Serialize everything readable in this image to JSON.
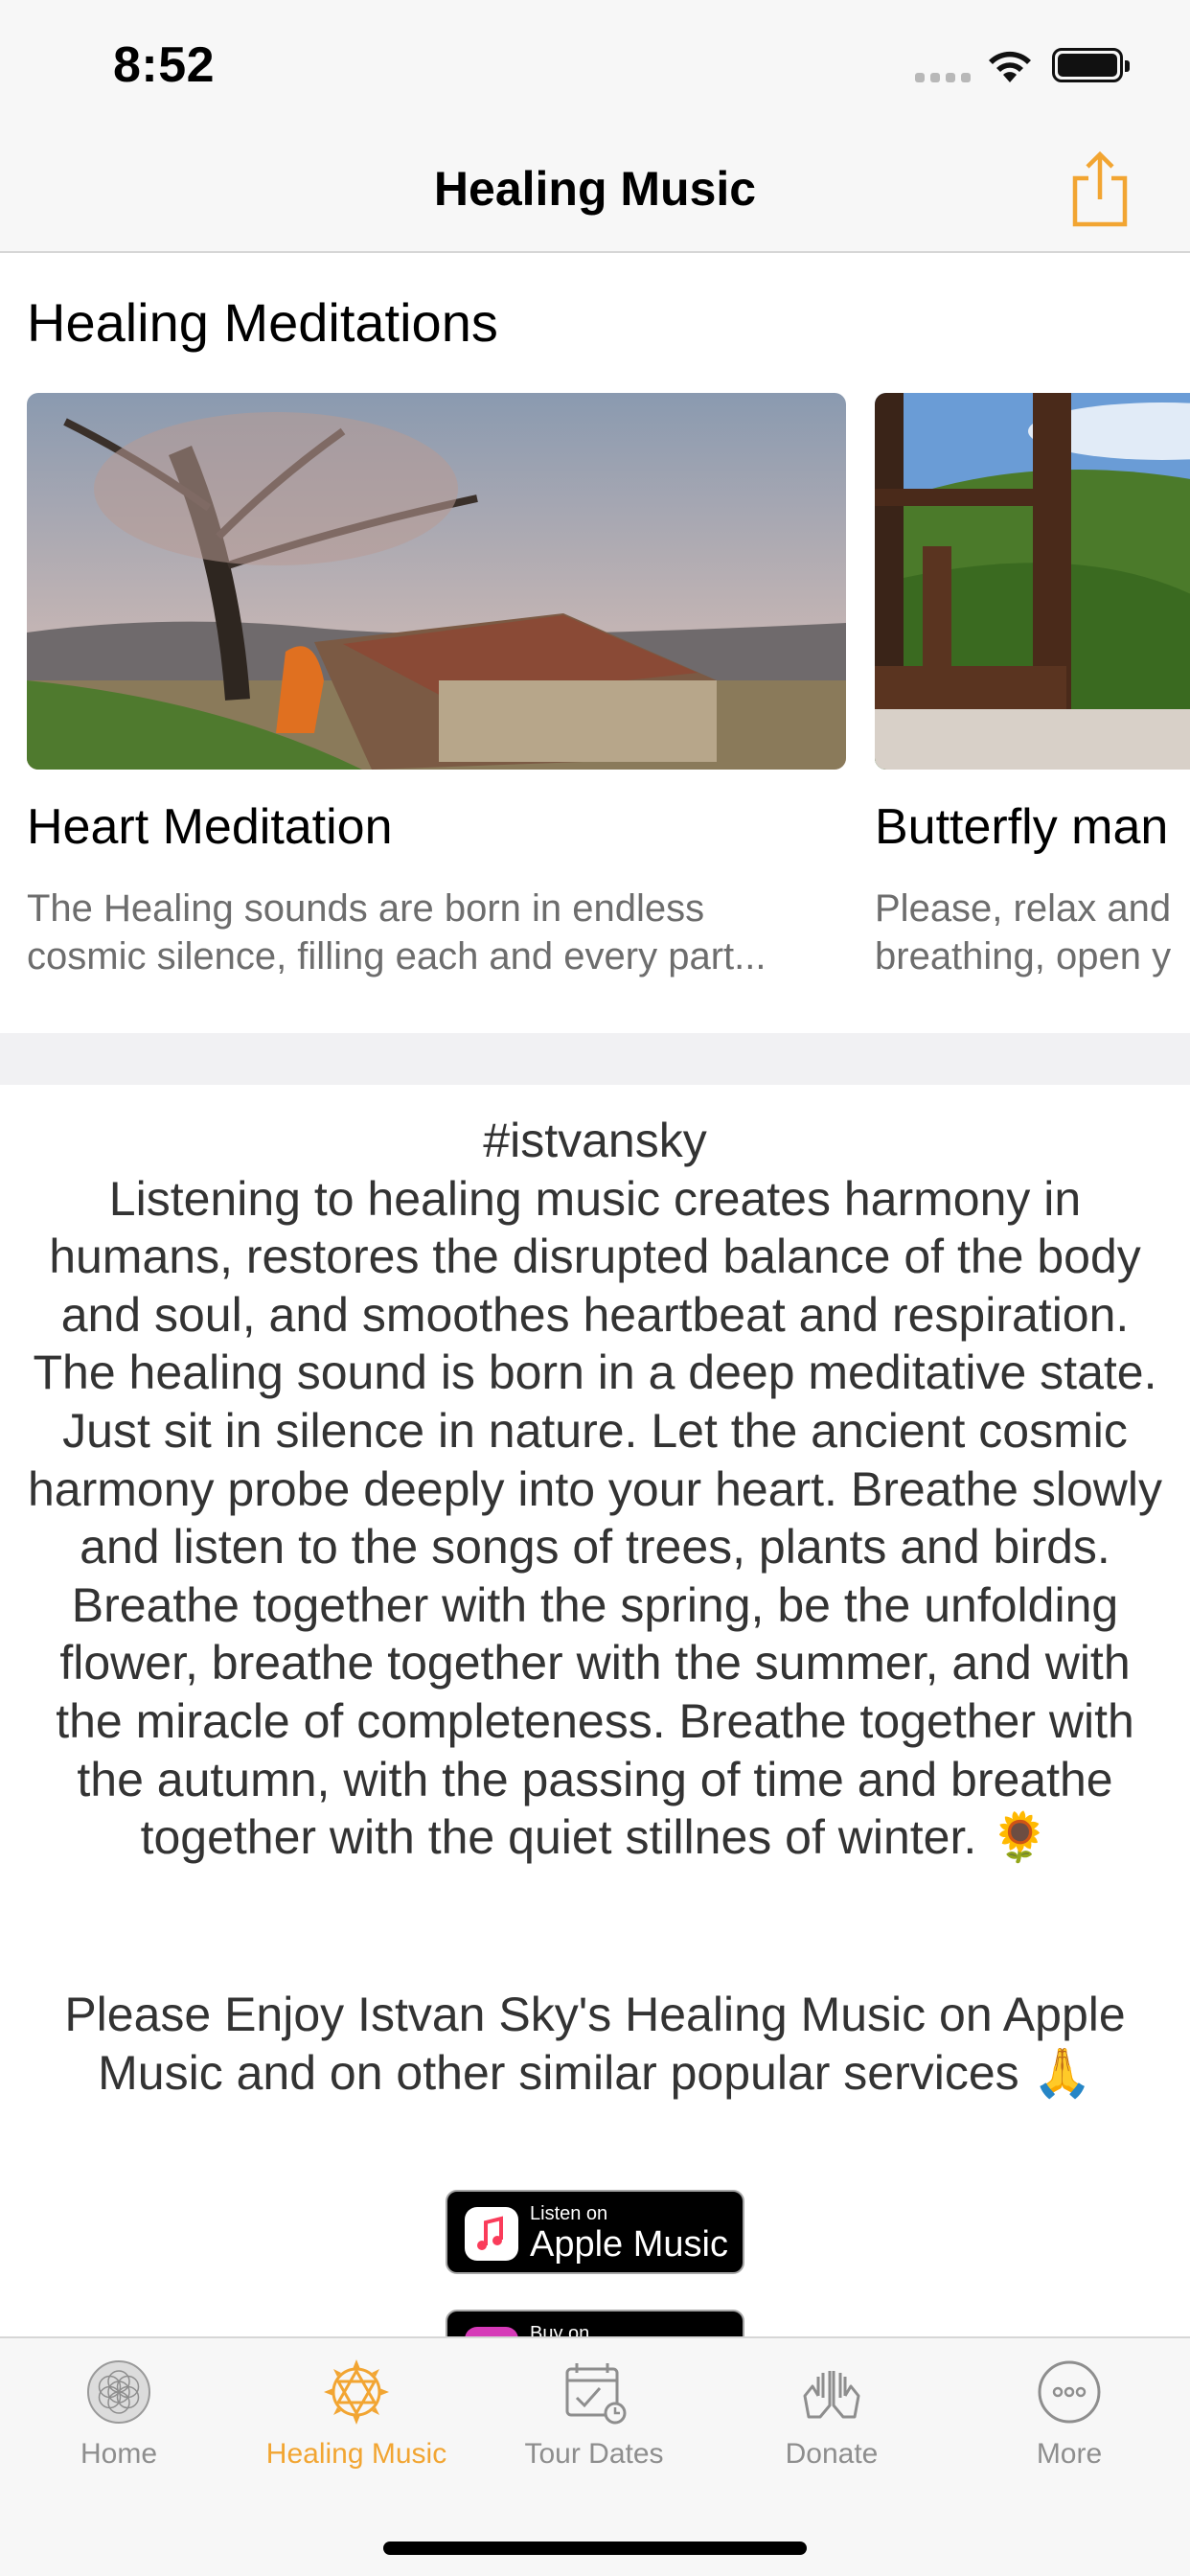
{
  "status_bar": {
    "time": "8:52"
  },
  "nav": {
    "title": "Healing Music",
    "share_icon": "share-icon",
    "accent": "#f2a532"
  },
  "section": {
    "title": "Healing Meditations"
  },
  "carousel": {
    "items": [
      {
        "title": "Heart Meditation",
        "description": "The Healing sounds are born in endless cosmic silence, filling each and every part..."
      },
      {
        "title": "Butterfly man",
        "description": "Please, relax and breathing, open y"
      }
    ]
  },
  "body": {
    "hashtag": "#istvansky",
    "paragraph": "Listening to healing music creates harmony in humans, restores the disrupted balance of the body and soul, and smoothes heartbeat and respiration. The healing sound is born in a deep meditative state. Just sit in silence in nature. Let the ancient cosmic harmony probe deeply into your heart. Breathe slowly and listen to the songs of trees, plants and birds. Breathe together with the spring, be the unfolding flower, breathe together with the summer, and with the miracle of completeness. Breathe together with the autumn, with the passing of time and breathe together with the quiet stillnes of winter. 🌻",
    "enjoy": "Please Enjoy Istvan Sky's Healing Music on Apple Music and on other similar popular services 🙏"
  },
  "badges": {
    "apple_music": {
      "small": "Listen on",
      "big": "Apple Music"
    },
    "itunes": {
      "small": "Buy on"
    }
  },
  "tabs": [
    {
      "label": "Home",
      "icon": "flower-of-life-icon",
      "active": false
    },
    {
      "label": "Healing Music",
      "icon": "star-of-david-icon",
      "active": true
    },
    {
      "label": "Tour Dates",
      "icon": "calendar-icon",
      "active": false
    },
    {
      "label": "Donate",
      "icon": "praying-hands-icon",
      "active": false
    },
    {
      "label": "More",
      "icon": "more-icon",
      "active": false
    }
  ]
}
